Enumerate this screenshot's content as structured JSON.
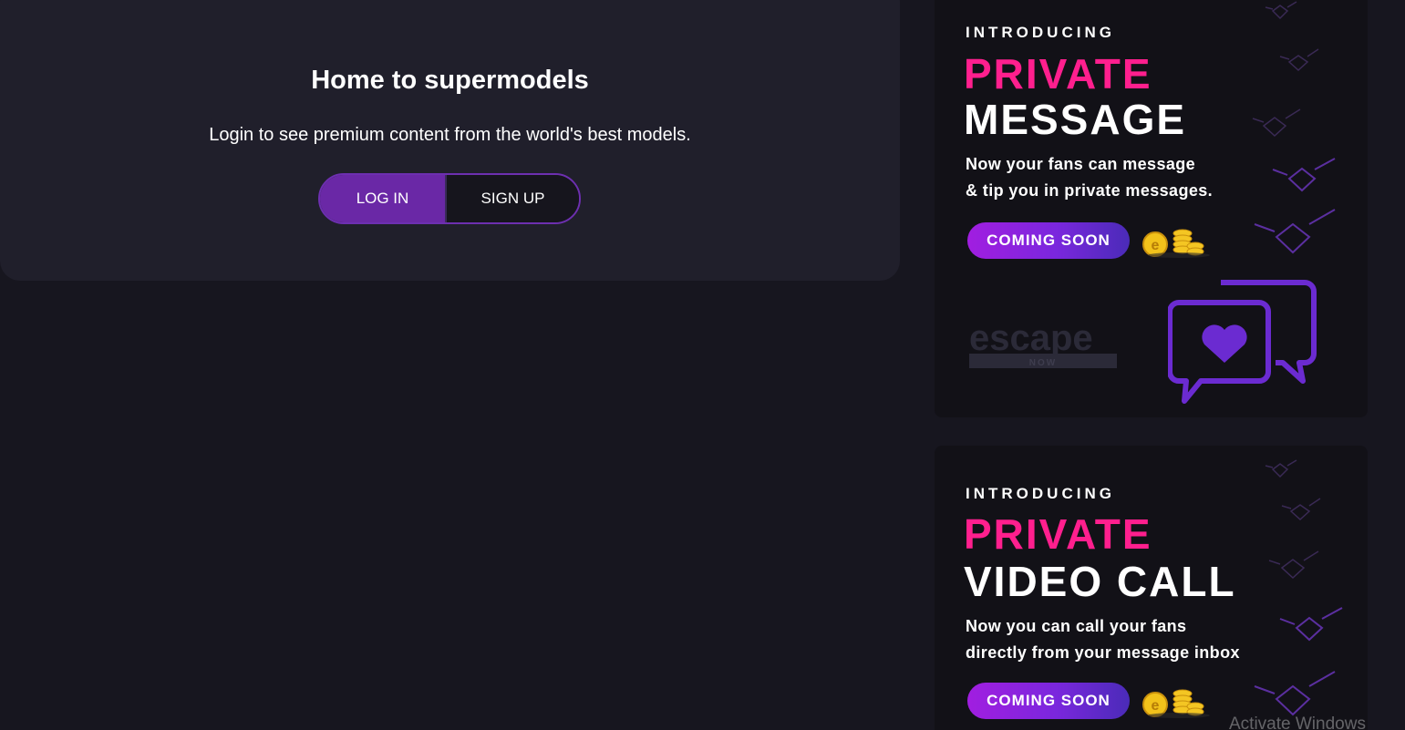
{
  "login": {
    "title": "Home to supermodels",
    "subtitle": "Login to see premium content from the world's best models.",
    "login_label": "LOG IN",
    "signup_label": "SIGN UP"
  },
  "promos": [
    {
      "intro": "INTRODUCING",
      "headline_pink": "PRIVATE",
      "headline_white": "MESSAGE",
      "desc_line1": "Now your fans can message",
      "desc_line2": "& tip you in private messages.",
      "cta": "COMING SOON",
      "logo_text": "escape",
      "logo_sub": "NOW",
      "icon": "chat-heart-icon"
    },
    {
      "intro": "INTRODUCING",
      "headline_pink": "PRIVATE",
      "headline_white": "VIDEO CALL",
      "desc_line1": "Now you can call your fans",
      "desc_line2": "directly from your message inbox",
      "cta": "COMING SOON"
    }
  ],
  "os_watermark": "Activate Windows",
  "colors": {
    "page_bg": "#17161f",
    "card_bg": "#201f2b",
    "accent_purple": "#6a28a6",
    "promo_pink": "#ff1f8e"
  }
}
